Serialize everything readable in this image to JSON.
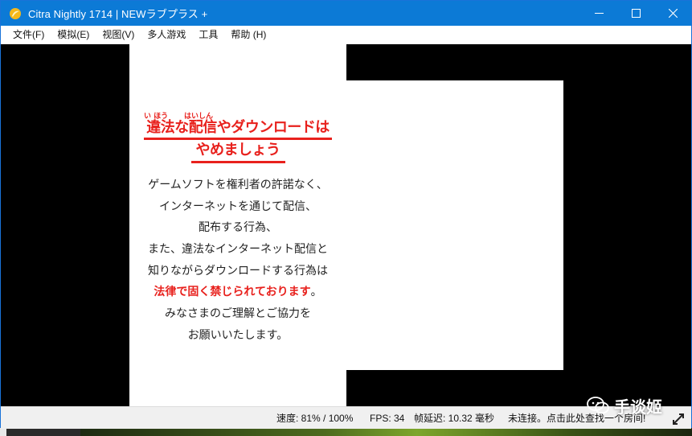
{
  "window": {
    "title": "Citra Nightly 1714 | NEWラブプラス +",
    "accent": "#0c7ad6"
  },
  "menu": {
    "items": [
      "文件(F)",
      "模拟(E)",
      "视图(V)",
      "多人游戏",
      "工具",
      "帮助 (H)"
    ]
  },
  "screen": {
    "furigana_1": "い ほう",
    "furigana_2": "はいしん",
    "warning_line1": "違法な配信やダウンロードは",
    "warning_line2": "やめましょう",
    "notice": [
      "ゲームソフトを権利者の許諾なく、",
      "インターネットを通じて配信、",
      "配布する行為、",
      "また、違法なインターネット配信と",
      "知りながらダウンロードする行為は",
      "法律で固く禁じられております",
      "みなさまのご理解とご協力を",
      "お願いいたします。"
    ],
    "notice_red_suffix": "。",
    "warning_color": "#e8211d"
  },
  "status": {
    "speed": "速度: 81% / 100%",
    "fps": "FPS: 34",
    "frame_latency": "帧延迟:  10.32 毫秒",
    "network": "未连接。点击此处查找一个房间!"
  },
  "watermark": {
    "text": "手谈姬",
    "icon": "wechat-icon"
  }
}
